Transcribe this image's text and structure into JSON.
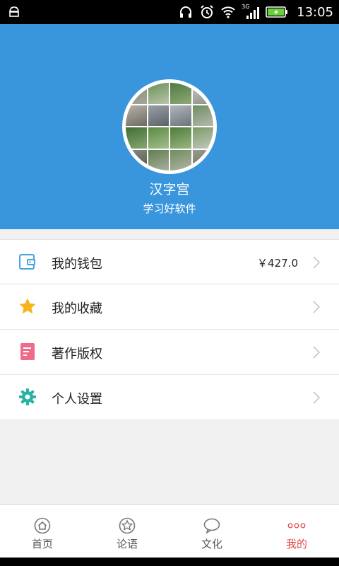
{
  "status_bar": {
    "time": "13:05",
    "network": "3G",
    "icons": [
      "android-icon",
      "headphones-icon",
      "alarm-icon",
      "wifi-icon",
      "signal-icon",
      "battery-icon"
    ]
  },
  "profile": {
    "name": "汉字宫",
    "tagline": "学习好软件"
  },
  "menu": {
    "items": [
      {
        "label": "我的钱包",
        "value": "￥427.0",
        "icon": "wallet-icon"
      },
      {
        "label": "我的收藏",
        "value": "",
        "icon": "star-icon"
      },
      {
        "label": "著作版权",
        "value": "",
        "icon": "document-icon"
      },
      {
        "label": "个人设置",
        "value": "",
        "icon": "gear-icon"
      }
    ]
  },
  "tabs": [
    {
      "label": "首页",
      "icon": "home-icon",
      "active": false
    },
    {
      "label": "论语",
      "icon": "star-circle-icon",
      "active": false
    },
    {
      "label": "文化",
      "icon": "chat-bubble-icon",
      "active": false
    },
    {
      "label": "我的",
      "icon": "more-dots-icon",
      "active": true
    }
  ],
  "colors": {
    "header": "#3a96dc",
    "active_tab": "#e04a4a",
    "star": "#f7b21c",
    "document": "#f06a8a",
    "gear": "#26b3a3",
    "wallet": "#4aa3e0"
  }
}
